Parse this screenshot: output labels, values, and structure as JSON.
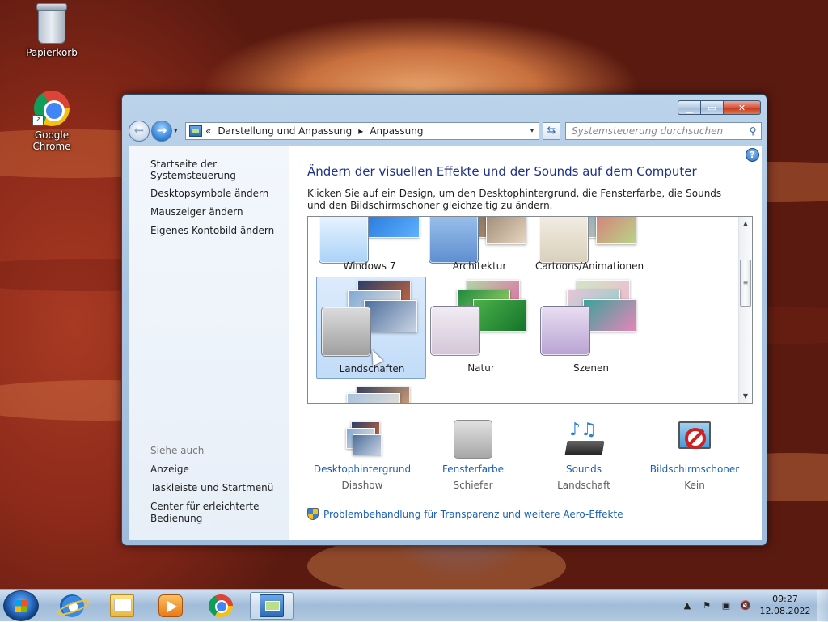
{
  "desktop": {
    "icons": [
      {
        "label": "Papierkorb",
        "icon": "recycle-bin-icon"
      },
      {
        "label": "Google Chrome",
        "icon": "chrome-icon"
      }
    ]
  },
  "window": {
    "caption_buttons": {
      "minimize": "minimize-icon",
      "maximize": "maximize-icon",
      "close": "close-icon"
    },
    "nav": {
      "back_glyph": "←",
      "forward_glyph": "→",
      "recent_glyph": "▾",
      "address_chevron": "«",
      "breadcrumb": [
        "Darstellung und Anpassung",
        "Anpassung"
      ],
      "separator": "▸",
      "dropdown_glyph": "▾",
      "refresh_glyph": "⇆",
      "search_placeholder": "Systemsteuerung durchsuchen",
      "search_glyph": "⚲"
    },
    "left_panel": {
      "home_link": "Startseite der Systemsteuerung",
      "links": [
        "Desktopsymbole ändern",
        "Mauszeiger ändern",
        "Eigenes Kontobild ändern"
      ],
      "see_also_label": "Siehe auch",
      "see_also": [
        "Anzeige",
        "Taskleiste und Startmenü",
        "Center für erleichterte",
        "Bedienung"
      ]
    },
    "main": {
      "help_glyph": "?",
      "title": "Ändern der visuellen Effekte und der Sounds auf dem Computer",
      "description": "Klicken Sie auf ein Design, um den Desktophintergrund, die Fensterfarbe, die Sounds und den Bildschirmschoner gleichzeitig zu ändern.",
      "themes": [
        {
          "label": "Windows 7",
          "selected": false
        },
        {
          "label": "Architektur",
          "selected": false
        },
        {
          "label": "Cartoons/Animationen",
          "selected": false
        },
        {
          "label": "Landschaften",
          "selected": true
        },
        {
          "label": "Natur",
          "selected": false
        },
        {
          "label": "Szenen",
          "selected": false
        }
      ],
      "scroll": {
        "up": "▲",
        "down": "▼",
        "grip": "≡"
      },
      "bottom_items": [
        {
          "label": "Desktophintergrund",
          "value": "Diashow",
          "icon": "desktop-background-icon"
        },
        {
          "label": "Fensterfarbe",
          "value": "Schiefer",
          "icon": "window-color-icon"
        },
        {
          "label": "Sounds",
          "value": "Landschaft",
          "icon": "sounds-icon"
        },
        {
          "label": "Bildschirmschoner",
          "value": "Kein",
          "icon": "screensaver-icon"
        }
      ],
      "aero_link": "Problembehandlung für Transparenz und weitere Aero-Effekte"
    }
  },
  "taskbar": {
    "apps": [
      "internet-explorer-icon",
      "explorer-icon",
      "media-player-icon",
      "chrome-icon",
      "control-panel-icon"
    ],
    "tray": {
      "expand_glyph": "▲",
      "flag_glyph": "⚑",
      "network_glyph": "▣",
      "volume_glyph": "🔇"
    },
    "clock": {
      "time": "09:27",
      "date": "12.08.2022"
    }
  },
  "colors": {
    "link": "#1a5fb4",
    "title": "#1e3287",
    "selection": "#c1dcf8"
  }
}
